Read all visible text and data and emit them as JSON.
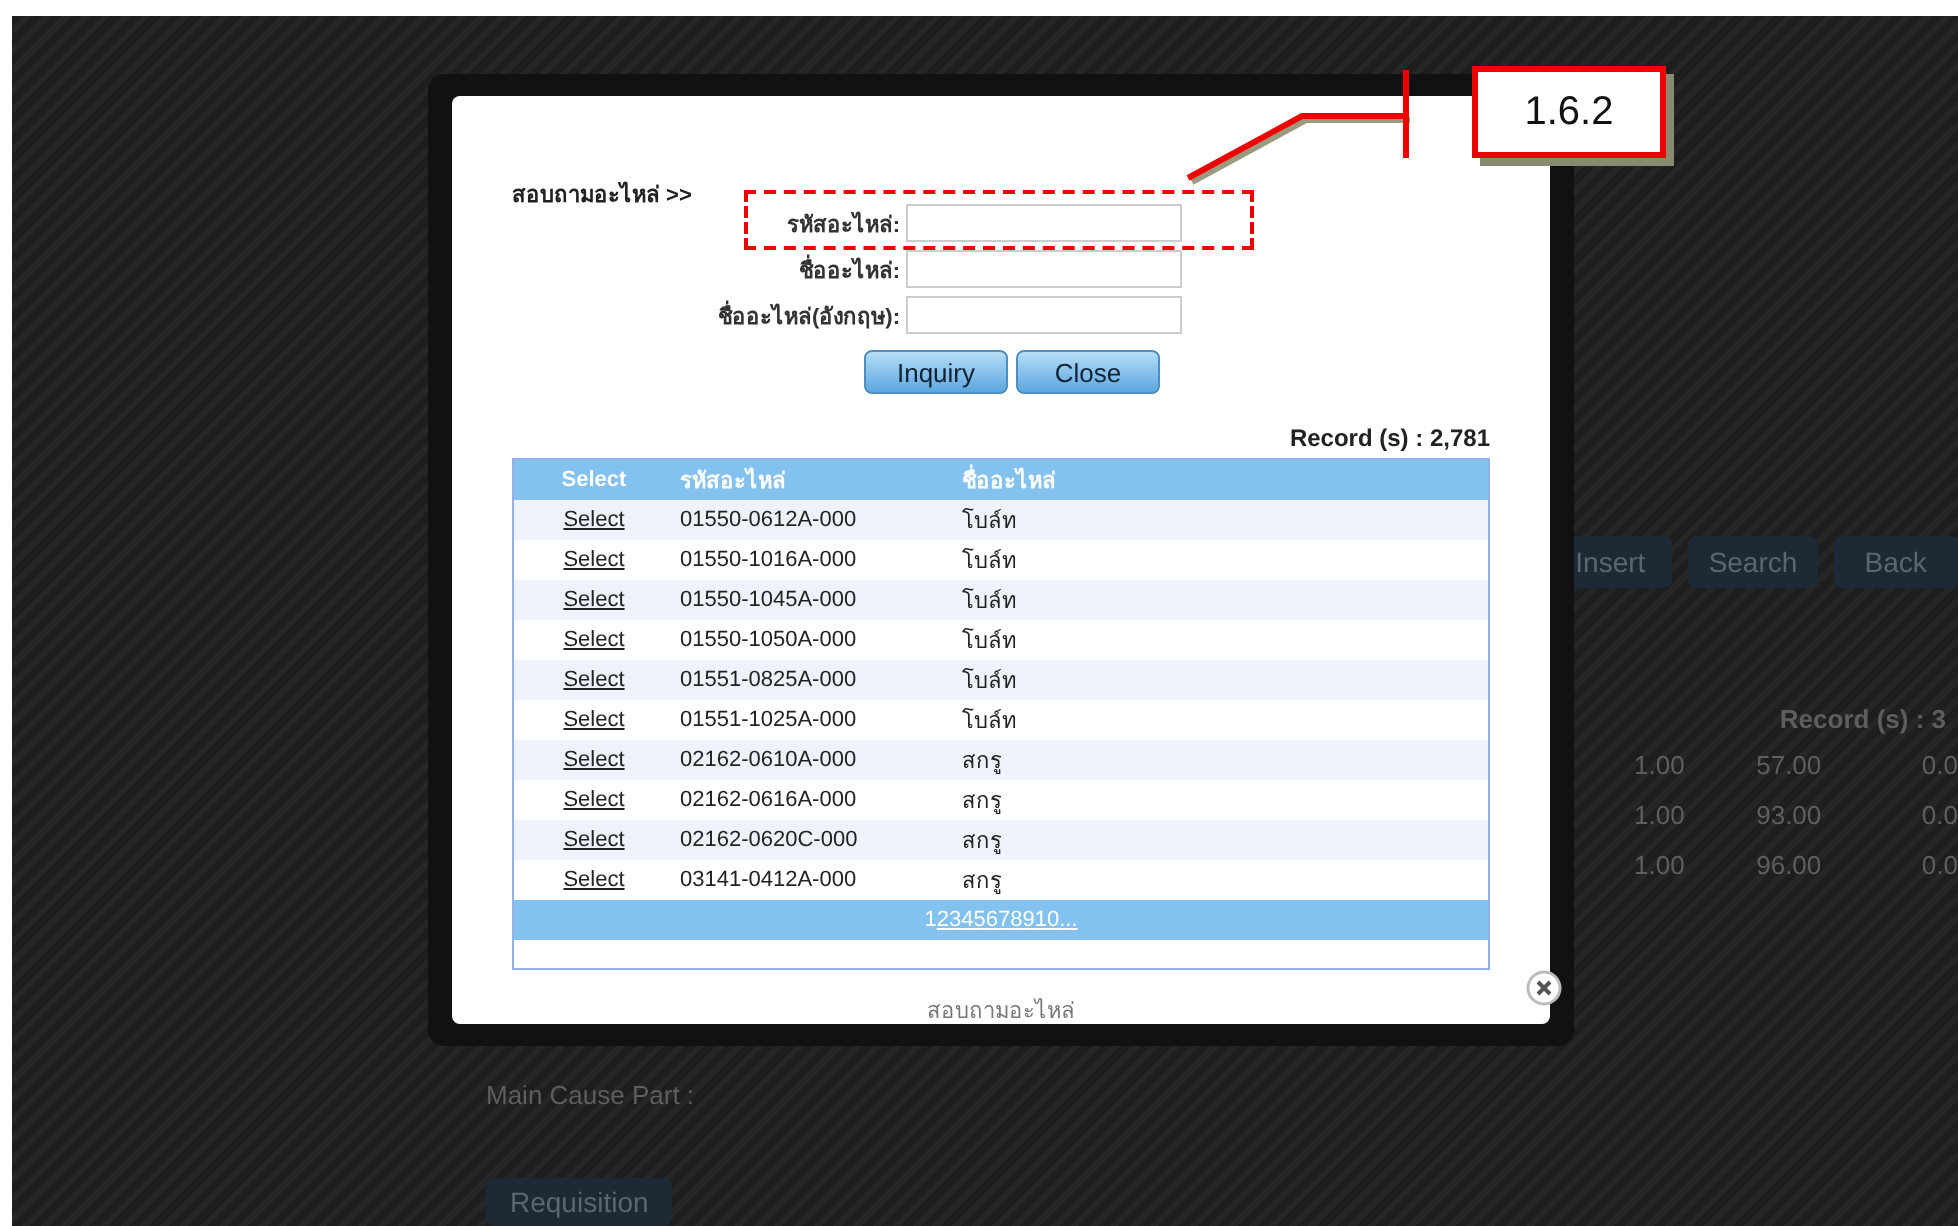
{
  "background": {
    "buttons": [
      "Insert",
      "Search",
      "Back"
    ],
    "record_count": "Record (s) : 3",
    "rows": [
      [
        "1.00",
        "57.00",
        "0.0"
      ],
      [
        "1.00",
        "93.00",
        "0.0"
      ],
      [
        "1.00",
        "96.00",
        "0.0"
      ]
    ],
    "main_cause_label": "Main Cause Part :",
    "requisition_button": "Requisition"
  },
  "modal": {
    "heading": "สอบถามอะไหล่ >>",
    "fields": [
      {
        "label": "รหัสอะไหล่:",
        "highlighted": true
      },
      {
        "label": "ชื่ออะไหล่:",
        "highlighted": false
      },
      {
        "label": "ชื่ออะไหล่(อังกฤษ):",
        "highlighted": false
      }
    ],
    "buttons": [
      "Inquiry",
      "Close"
    ],
    "record_count": "Record (s) : 2,781",
    "columns": [
      "Select",
      "รหัสอะไหล่",
      "ชื่ออะไหล่"
    ],
    "rows": [
      {
        "action": "Select",
        "code": "01550-0612A-000",
        "name": "โบล์ท"
      },
      {
        "action": "Select",
        "code": "01550-1016A-000",
        "name": "โบล์ท"
      },
      {
        "action": "Select",
        "code": "01550-1045A-000",
        "name": "โบล์ท"
      },
      {
        "action": "Select",
        "code": "01550-1050A-000",
        "name": "โบล์ท"
      },
      {
        "action": "Select",
        "code": "01551-0825A-000",
        "name": "โบล์ท"
      },
      {
        "action": "Select",
        "code": "01551-1025A-000",
        "name": "โบล์ท"
      },
      {
        "action": "Select",
        "code": "02162-0610A-000",
        "name": "สกรู"
      },
      {
        "action": "Select",
        "code": "02162-0616A-000",
        "name": "สกรู"
      },
      {
        "action": "Select",
        "code": "02162-0620C-000",
        "name": "สกรู"
      },
      {
        "action": "Select",
        "code": "03141-0412A-000",
        "name": "สกรู"
      }
    ],
    "pages": [
      {
        "label": "1",
        "selected": true
      },
      {
        "label": "2",
        "selected": false
      },
      {
        "label": "3",
        "selected": false
      },
      {
        "label": "4",
        "selected": false
      },
      {
        "label": "5",
        "selected": false
      },
      {
        "label": "6",
        "selected": false
      },
      {
        "label": "7",
        "selected": false
      },
      {
        "label": "8",
        "selected": false
      },
      {
        "label": "9",
        "selected": false
      },
      {
        "label": "10",
        "selected": false
      },
      {
        "label": "...",
        "selected": false
      }
    ],
    "caption": "สอบถามอะไหล่"
  },
  "annotation": {
    "label": "1.6.2"
  }
}
